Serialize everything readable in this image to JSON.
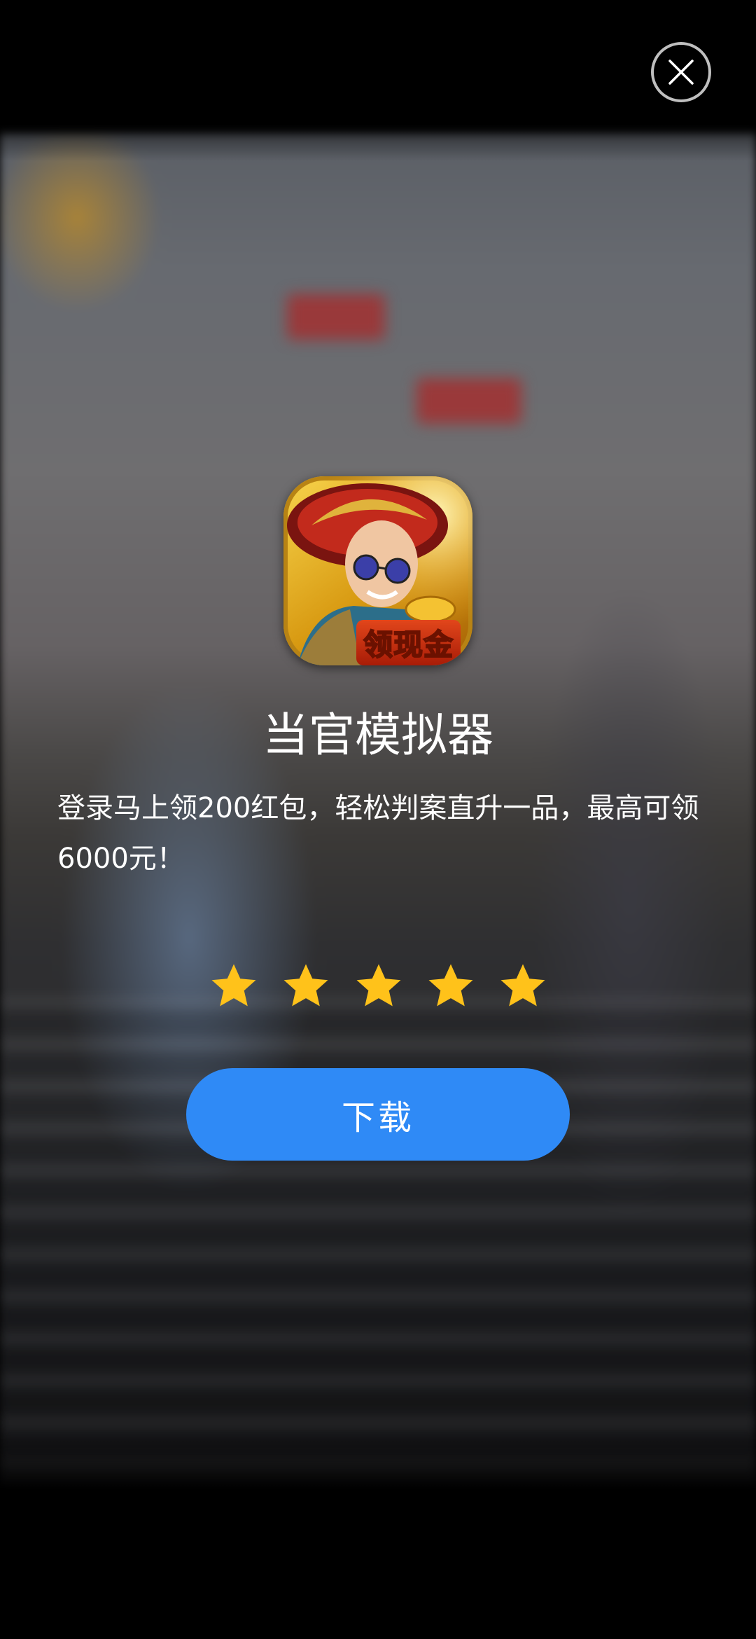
{
  "close_button": {
    "icon": "close-icon"
  },
  "app": {
    "name": "当官模拟器",
    "icon_badge": "领现金",
    "description": "登录马上领200红包，轻松判案直升一品，最高可领6000元！"
  },
  "rating": {
    "stars": 5,
    "max": 5,
    "star_color": "#FFC21A"
  },
  "download_button": {
    "label": "下载",
    "color": "#2F8AF6"
  }
}
